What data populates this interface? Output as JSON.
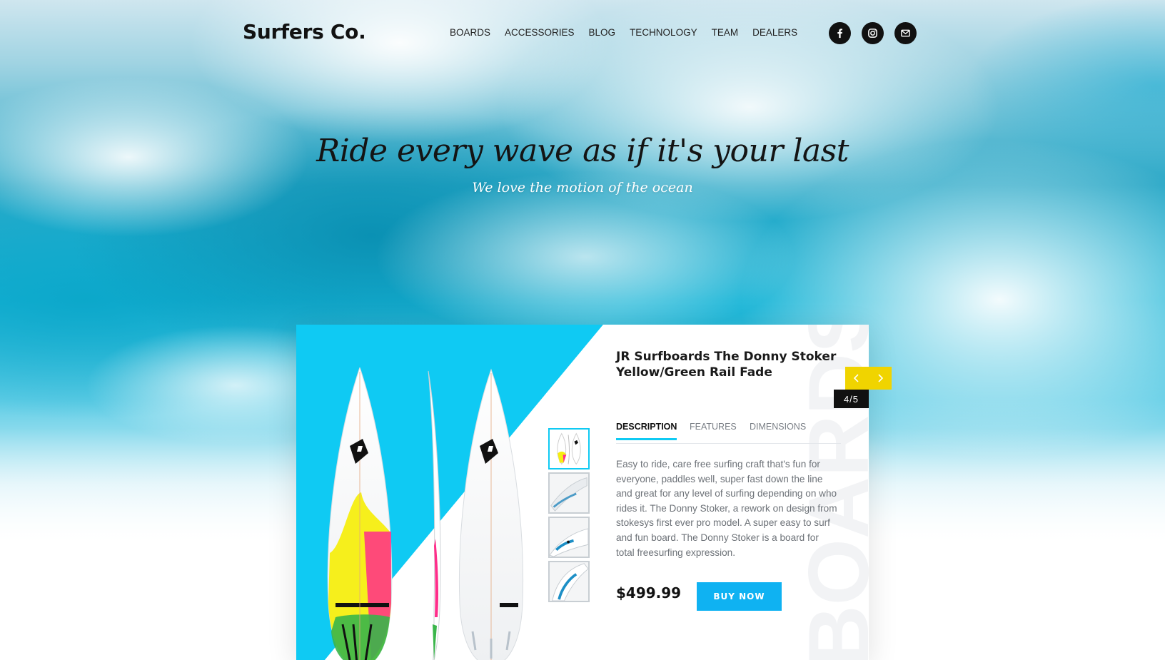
{
  "header": {
    "brand": "Surfers Co.",
    "nav": [
      "BOARDS",
      "ACCESSORIES",
      "BLOG",
      "TECHNOLOGY",
      "TEAM",
      "DEALERS"
    ],
    "socials": [
      {
        "icon": "facebook-icon"
      },
      {
        "icon": "instagram-icon"
      },
      {
        "icon": "mail-icon"
      }
    ]
  },
  "hero": {
    "tagline": "Ride every wave as if it's your last",
    "subtagline": "We love the motion of the ocean"
  },
  "product": {
    "title": "JR Surfboards The Donny Stoker Yellow/Green Rail Fade",
    "tabs": [
      "DESCRIPTION",
      "FEATURES",
      "DIMENSIONS"
    ],
    "active_tab": "DESCRIPTION",
    "description": "Easy to ride, care free surfing craft that's fun for everyone, paddles well, super fast down the line and great for any level of surfing depending on who rides it. The Donny Stoker, a rework on design from stokesys first ever pro model. A super easy to surf and fun board. The Donny Stoker is a board for total freesurfing expression.",
    "price": "$499.99",
    "buy_label": "BUY NOW",
    "watermark": "BOARDS",
    "thumbnails": 4,
    "active_thumbnail": 1
  },
  "slider": {
    "counter": "4/5",
    "prev_icon": "chevron-left-icon",
    "next_icon": "chevron-right-icon"
  },
  "colors": {
    "accent_blue": "#0fcaf3",
    "button_blue": "#0fb2f2",
    "slider_yellow": "#f0d400",
    "text_dark": "#111111"
  }
}
